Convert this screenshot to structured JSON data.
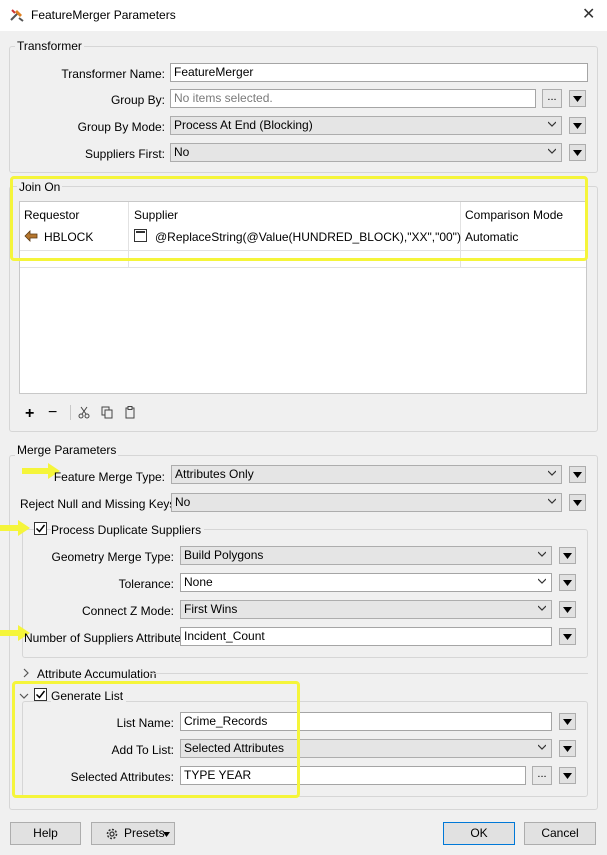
{
  "window": {
    "title": "FeatureMerger Parameters"
  },
  "transformer": {
    "group_label": "Transformer",
    "name_label": "Transformer Name:",
    "name_value": "FeatureMerger",
    "group_by_label": "Group By:",
    "group_by_placeholder": "No items selected.",
    "group_by_mode_label": "Group By Mode:",
    "group_by_mode_value": "Process At End (Blocking)",
    "suppliers_first_label": "Suppliers First:",
    "suppliers_first_value": "No"
  },
  "join_on": {
    "group_label": "Join On",
    "columns": [
      "Requestor",
      "Supplier",
      "Comparison Mode"
    ],
    "rows": [
      {
        "requestor": "HBLOCK",
        "supplier": "@ReplaceString(@Value(HUNDRED_BLOCK),\"XX\",\"00\")",
        "mode": "Automatic"
      }
    ]
  },
  "merge": {
    "group_label": "Merge Parameters",
    "feature_merge_type_label": "Feature Merge Type:",
    "feature_merge_type_value": "Attributes Only",
    "reject_null_label": "Reject Null and Missing Keys:",
    "reject_null_value": "No",
    "process_duplicates_label": "Process Duplicate Suppliers",
    "geometry_merge_type_label": "Geometry Merge Type:",
    "geometry_merge_type_value": "Build Polygons",
    "tolerance_label": "Tolerance:",
    "tolerance_value": "None",
    "connect_z_label": "Connect Z Mode:",
    "connect_z_value": "First Wins",
    "num_suppliers_label": "Number of Suppliers Attribute:",
    "num_suppliers_value": "Incident_Count",
    "attr_accum_label": "Attribute Accumulation",
    "generate_list_label": "Generate List",
    "list_name_label": "List Name:",
    "list_name_value": "Crime_Records",
    "add_to_list_label": "Add To List:",
    "add_to_list_value": "Selected Attributes",
    "selected_attrs_label": "Selected Attributes:",
    "selected_attrs_value": "TYPE YEAR"
  },
  "footer": {
    "help": "Help",
    "presets": "Presets",
    "ok": "OK",
    "cancel": "Cancel"
  },
  "colors": {
    "highlight": "#f5f53a",
    "accent": "#0078d7"
  }
}
